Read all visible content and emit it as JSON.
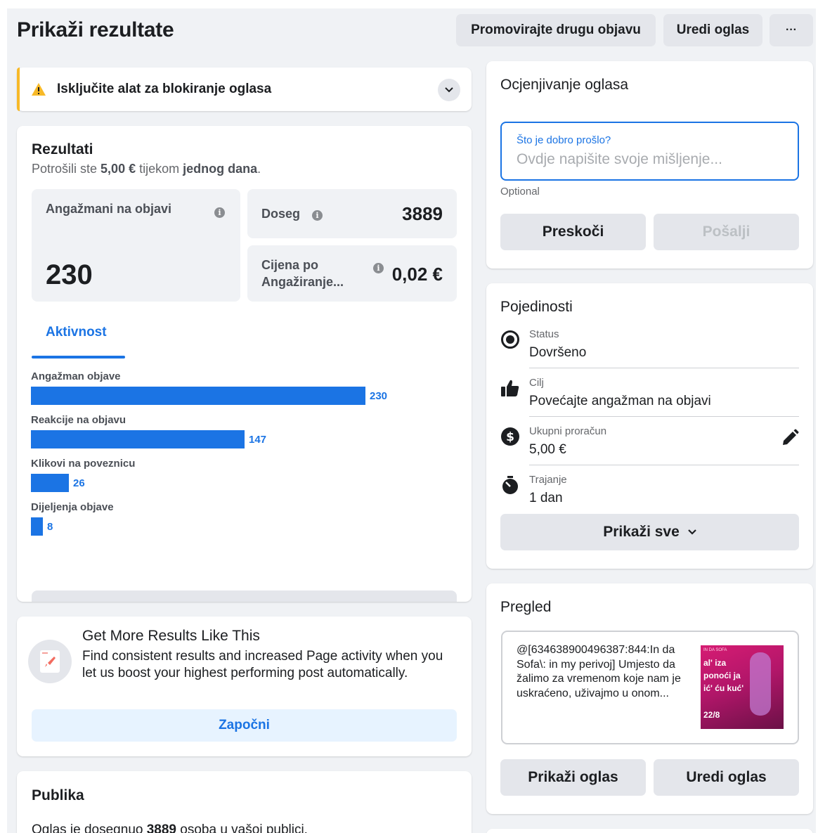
{
  "header": {
    "title": "Prikaži rezultate",
    "promote_button": "Promovirajte drugu objavu",
    "edit_button": "Uredi oglas",
    "more_button": "···"
  },
  "alert": {
    "text": "Isključite alat za blokiranje oglasa"
  },
  "results": {
    "title": "Rezultati",
    "summary_prefix": "Potrošili ste ",
    "summary_amount": "5,00 €",
    "summary_mid": " tijekom ",
    "summary_period": "jednog dana",
    "summary_suffix": ".",
    "engagement_label": "Angažmani na objavi",
    "engagement_value": "230",
    "reach_label": "Doseg",
    "reach_value": "3889",
    "cost_label_line1": "Cijena po",
    "cost_label_line2": "Angažiranje...",
    "cost_value": "0,02 €",
    "tab_activity": "Aktivnost"
  },
  "chart_data": {
    "type": "bar",
    "categories": [
      "Angažman objave",
      "Reakcije na objavu",
      "Klikovi na poveznicu",
      "Dijeljenja objave"
    ],
    "values": [
      230,
      147,
      26,
      8
    ]
  },
  "promo": {
    "title": "Get More Results Like This",
    "body": "Find consistent results and increased Page activity when you let us boost your highest performing post automatically.",
    "button": "Započni"
  },
  "audience": {
    "title": "Publika",
    "text_prefix": "Oglas je dosegnuo ",
    "text_count": "3889",
    "text_suffix": " osoba u vašoj publici."
  },
  "rating": {
    "title": "Ocjenjivanje oglasa",
    "input_label": "Što je dobro prošlo?",
    "input_placeholder": "Ovdje napišite svoje mišljenje...",
    "optional": "Optional",
    "skip_button": "Preskoči",
    "send_button": "Pošalji"
  },
  "details": {
    "title": "Pojedinosti",
    "rows": [
      {
        "label": "Status",
        "value": "Dovršeno",
        "icon": "status-icon"
      },
      {
        "label": "Cilj",
        "value": "Povećajte angažman na objavi",
        "icon": "thumbs-up-icon"
      },
      {
        "label": "Ukupni proračun",
        "value": "5,00 €",
        "icon": "dollar-icon"
      },
      {
        "label": "Trajanje",
        "value": "1 dan",
        "icon": "stopwatch-icon"
      }
    ],
    "show_all": "Prikaži sve"
  },
  "preview": {
    "title": "Pregled",
    "post_text": "@[634638900496387:844:In da Sofa\\: in my perivoj] Umjesto da žalimo za vremenom koje nam je uskraćeno, uživajmo u onom...",
    "thumb_top": "IN DA SOFA",
    "thumb_line1": "al' iza",
    "thumb_line2": "ponoći ja",
    "thumb_line3": "ić' ću kuć'",
    "thumb_date": "22/8",
    "show_ad_button": "Prikaži oglas",
    "edit_ad_button": "Uredi oglas"
  },
  "colors": {
    "accent": "#1b74e4",
    "warning": "#f7b928",
    "background": "#f0f2f5"
  }
}
